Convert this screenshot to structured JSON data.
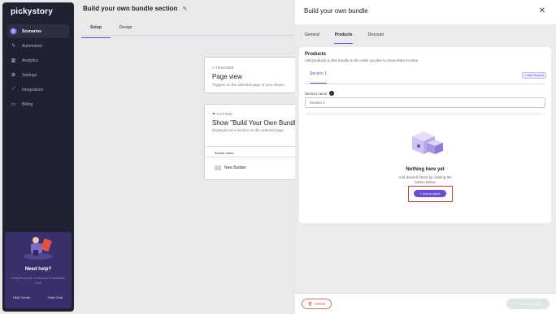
{
  "app": {
    "logo": "pickystory"
  },
  "sidebar": {
    "items": [
      {
        "label": "Scenarios",
        "icon": "scenarios-icon"
      },
      {
        "label": "Automation",
        "icon": "bolt-icon"
      },
      {
        "label": "Analytics",
        "icon": "chart-icon"
      },
      {
        "label": "Settings",
        "icon": "gear-icon"
      },
      {
        "label": "Integrations",
        "icon": "plug-icon"
      },
      {
        "label": "Billing",
        "icon": "card-icon"
      }
    ],
    "help": {
      "title": "Need help?",
      "text": "PickyStory live chat team is Available 24/6",
      "help_center": "Help Center",
      "start_chat": "Start Chat"
    }
  },
  "page": {
    "title": "Build your own bundle section",
    "tabs": [
      "Setup",
      "Design"
    ],
    "trigger": {
      "kicker": "TRIGGER",
      "title": "Page view",
      "sub": "Triggers on the selected page of your choice"
    },
    "action": {
      "kicker": "ACTION",
      "title": "Show \"Build Your Own Bundle\"",
      "sub": "Displayed as a section on the selected page",
      "col_header": "Bundle name",
      "row": "New Builder"
    }
  },
  "drawer": {
    "title": "Build your own bundle",
    "tabs": [
      "General",
      "Products",
      "Discount"
    ],
    "active_tab": "Products",
    "products": {
      "title": "Products",
      "desc": "Add products to this bundle in the order you like to show them in-store",
      "section_tab": "Section 1",
      "add_section": "+ Add Section",
      "field_label": "Section name",
      "field_value": "Section 1",
      "empty_title": "Nothing here yet",
      "empty_desc": "Add desired items by clicking the button below",
      "add_product": "+ Add product"
    },
    "footer": {
      "delete": "Delete",
      "save": "Save changes"
    }
  },
  "colors": {
    "accent": "#6c4ad1",
    "sidebar_bg": "#1f2230",
    "highlight": "#d93a32",
    "danger": "#d9534f"
  }
}
